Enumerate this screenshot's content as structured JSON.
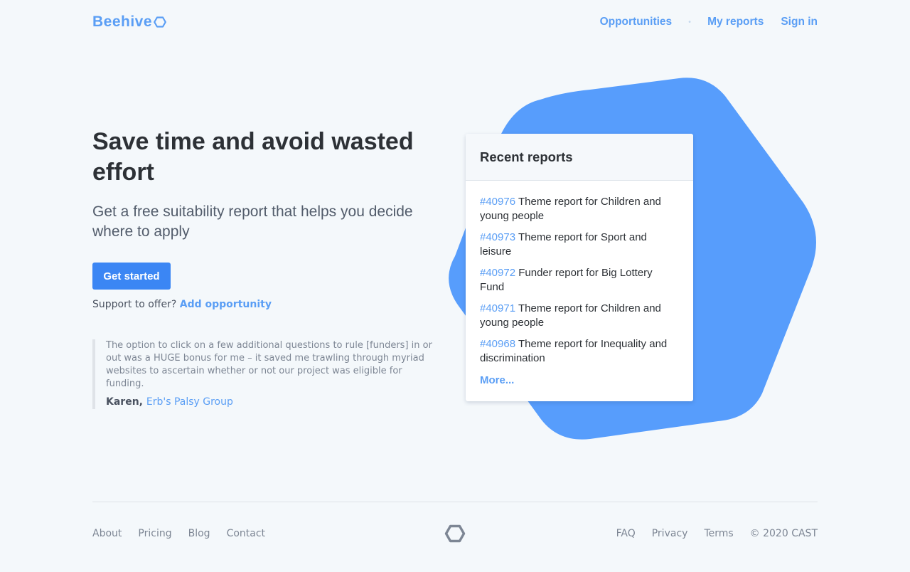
{
  "brand": {
    "name": "Beehive",
    "icon": "hexagon-icon",
    "accent_color": "#5a9ef5",
    "button_color": "#3b86f4",
    "blob_color": "#579dfc"
  },
  "nav": {
    "items": [
      {
        "label": "Opportunities"
      },
      {
        "label": "My reports"
      },
      {
        "label": "Sign in"
      }
    ],
    "separator": "•"
  },
  "hero": {
    "title": "Save time and avoid wasted effort",
    "subtitle": "Get a free suitability report that helps you decide where to apply",
    "cta_label": "Get started",
    "support_text": "Support to offer?",
    "support_link": "Add opportunity"
  },
  "testimonial": {
    "quote": "The option to click on a few additional questions to rule [funders] in or out was a HUGE bonus for me – it saved me trawling through myriad websites to ascertain whether or not our project was eligible for funding.",
    "author": "Karen,",
    "organisation": "Erb's Palsy Group"
  },
  "recent_reports": {
    "title": "Recent reports",
    "items": [
      {
        "id": "#40976",
        "text": "Theme report for Children and young people"
      },
      {
        "id": "#40973",
        "text": "Theme report for Sport and leisure"
      },
      {
        "id": "#40972",
        "text": "Funder report for Big Lottery Fund"
      },
      {
        "id": "#40971",
        "text": "Theme report for Children and young people"
      },
      {
        "id": "#40968",
        "text": "Theme report for Inequality and discrimination"
      }
    ],
    "more_label": "More..."
  },
  "footer": {
    "left_links": [
      {
        "label": "About"
      },
      {
        "label": "Pricing"
      },
      {
        "label": "Blog"
      },
      {
        "label": "Contact"
      }
    ],
    "logo_icon": "hexagon-icon",
    "right_links": [
      {
        "label": "FAQ"
      },
      {
        "label": "Privacy"
      },
      {
        "label": "Terms"
      }
    ],
    "copyright": "© 2020 CAST"
  }
}
